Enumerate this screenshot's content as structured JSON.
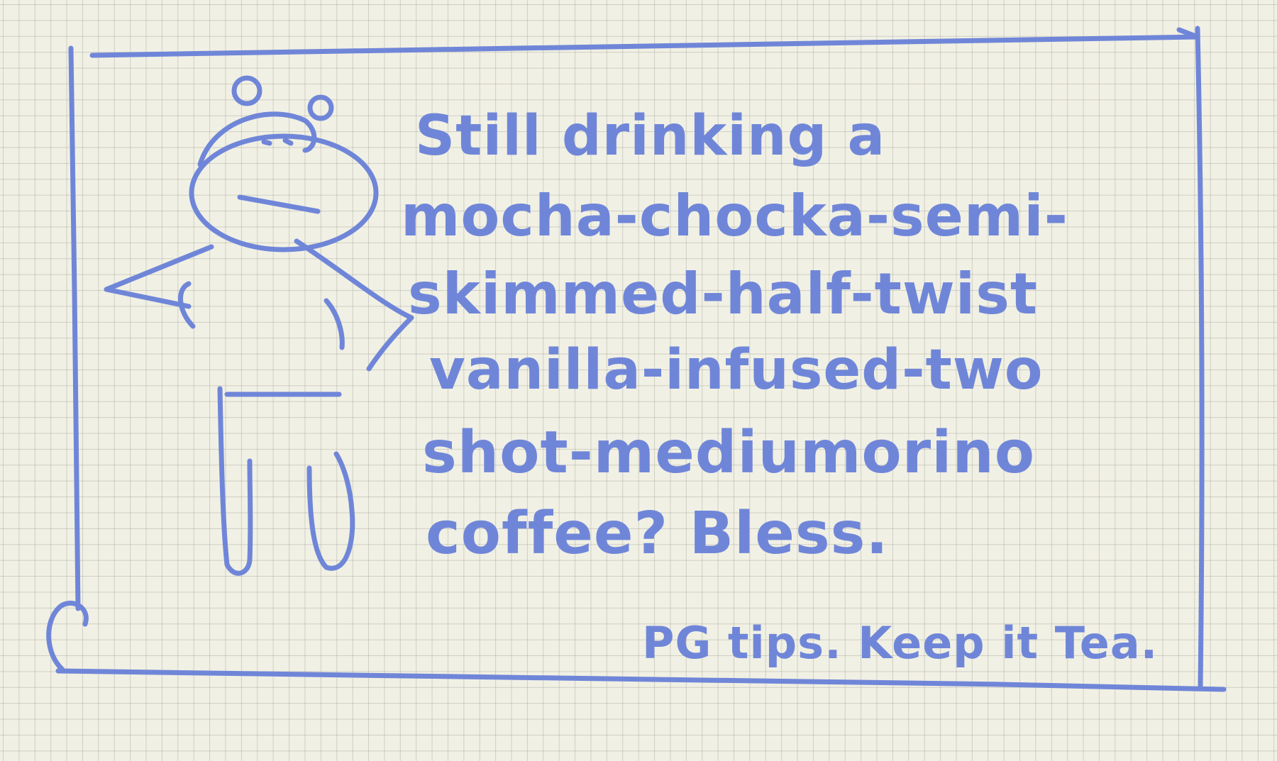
{
  "note": {
    "lines": [
      "Still drinking a",
      "mocha-chocka-semi-",
      "skimmed-half-twist",
      "vanilla-infused-two",
      "shot-mediumorino",
      "coffee? Bless.",
      "PG tips. Keep it Tea."
    ]
  },
  "colors": {
    "paper": "#f1f0e4",
    "grid": "#8a8a84",
    "ink": "#6f86d8"
  },
  "icons": {
    "doodle": "hippo-figure-icon"
  }
}
